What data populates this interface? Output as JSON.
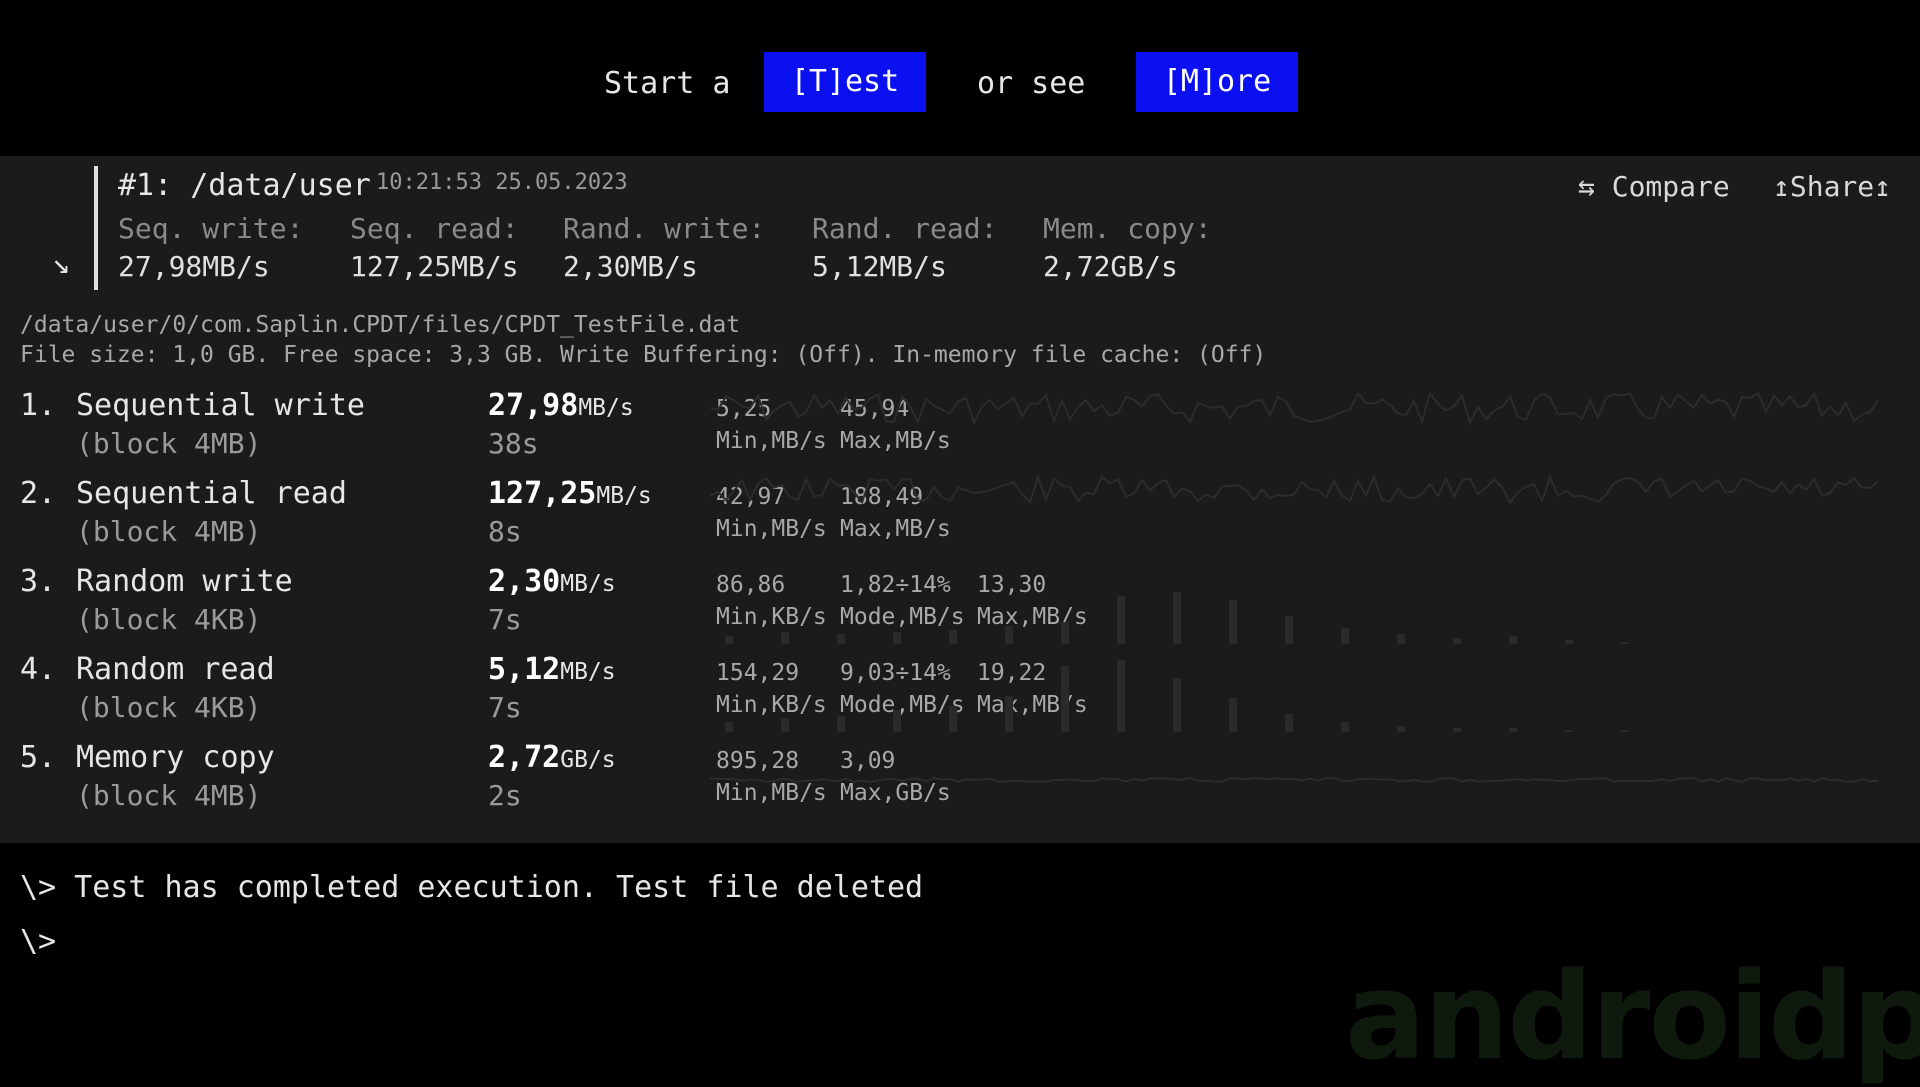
{
  "top": {
    "prefix": "Start a",
    "test_button": "[T]est",
    "middle": "or see",
    "more_button": "[M]ore"
  },
  "run": {
    "title": "#1: /data/user",
    "time": "10:21:53 25.05.2023",
    "compare": "⇆ Compare",
    "share": "↥Share↥",
    "expand_icon": "arrow-down-right-icon",
    "summary": [
      {
        "label": "Seq. write:",
        "value": "27,98MB/s"
      },
      {
        "label": "Seq. read:",
        "value": "127,25MB/s"
      },
      {
        "label": "Rand. write:",
        "value": "2,30MB/s"
      },
      {
        "label": "Rand. read:",
        "value": "5,12MB/s"
      },
      {
        "label": "Mem. copy:",
        "value": "2,72GB/s"
      }
    ]
  },
  "file_path": "/data/user/0/com.Saplin.CPDT/files/CPDT_TestFile.dat",
  "file_info": "File size: 1,0 GB. Free space: 3,3 GB. Write Buffering: (Off). In-memory file cache: (Off)",
  "tests": [
    {
      "num": "1.",
      "name": "Sequential write",
      "block": "(block 4MB)",
      "speed": "27,98",
      "unit": "MB/s",
      "time": "38s",
      "stats": [
        {
          "value": "5,25",
          "label": "Min,MB/s"
        },
        {
          "value": "45,94",
          "label": "Max,MB/s"
        }
      ]
    },
    {
      "num": "2.",
      "name": "Sequential read",
      "block": "(block 4MB)",
      "speed": "127,25",
      "unit": "MB/s",
      "time": "8s",
      "stats": [
        {
          "value": "42,97",
          "label": "Min,MB/s"
        },
        {
          "value": "188,49",
          "label": "Max,MB/s"
        }
      ]
    },
    {
      "num": "3.",
      "name": "Random write",
      "block": "(block 4KB)",
      "speed": "2,30",
      "unit": "MB/s",
      "time": "7s",
      "stats": [
        {
          "value": "86,86",
          "label": "Min,KB/s"
        },
        {
          "value": "1,82÷14%",
          "label": "Mode,MB/s"
        },
        {
          "value": "13,30",
          "label": "Max,MB/s"
        }
      ]
    },
    {
      "num": "4.",
      "name": "Random read",
      "block": "(block 4KB)",
      "speed": "5,12",
      "unit": "MB/s",
      "time": "7s",
      "stats": [
        {
          "value": "154,29",
          "label": "Min,KB/s"
        },
        {
          "value": "9,03÷14%",
          "label": "Mode,MB/s"
        },
        {
          "value": "19,22",
          "label": "Max,MB/s"
        }
      ]
    },
    {
      "num": "5.",
      "name": "Memory copy",
      "block": "(block 4MB)",
      "speed": "2,72",
      "unit": "GB/s",
      "time": "2s",
      "stats": [
        {
          "value": "895,28",
          "label": "Min,MB/s"
        },
        {
          "value": "3,09",
          "label": "Max,GB/s"
        }
      ]
    }
  ],
  "console": {
    "line1": "\\> Test has completed execution. Test file deleted",
    "line2": "\\>"
  },
  "watermark": "androidpc",
  "colors": {
    "button": "#0a10f0",
    "panel": "#1b1b1b",
    "background": "#000000"
  }
}
